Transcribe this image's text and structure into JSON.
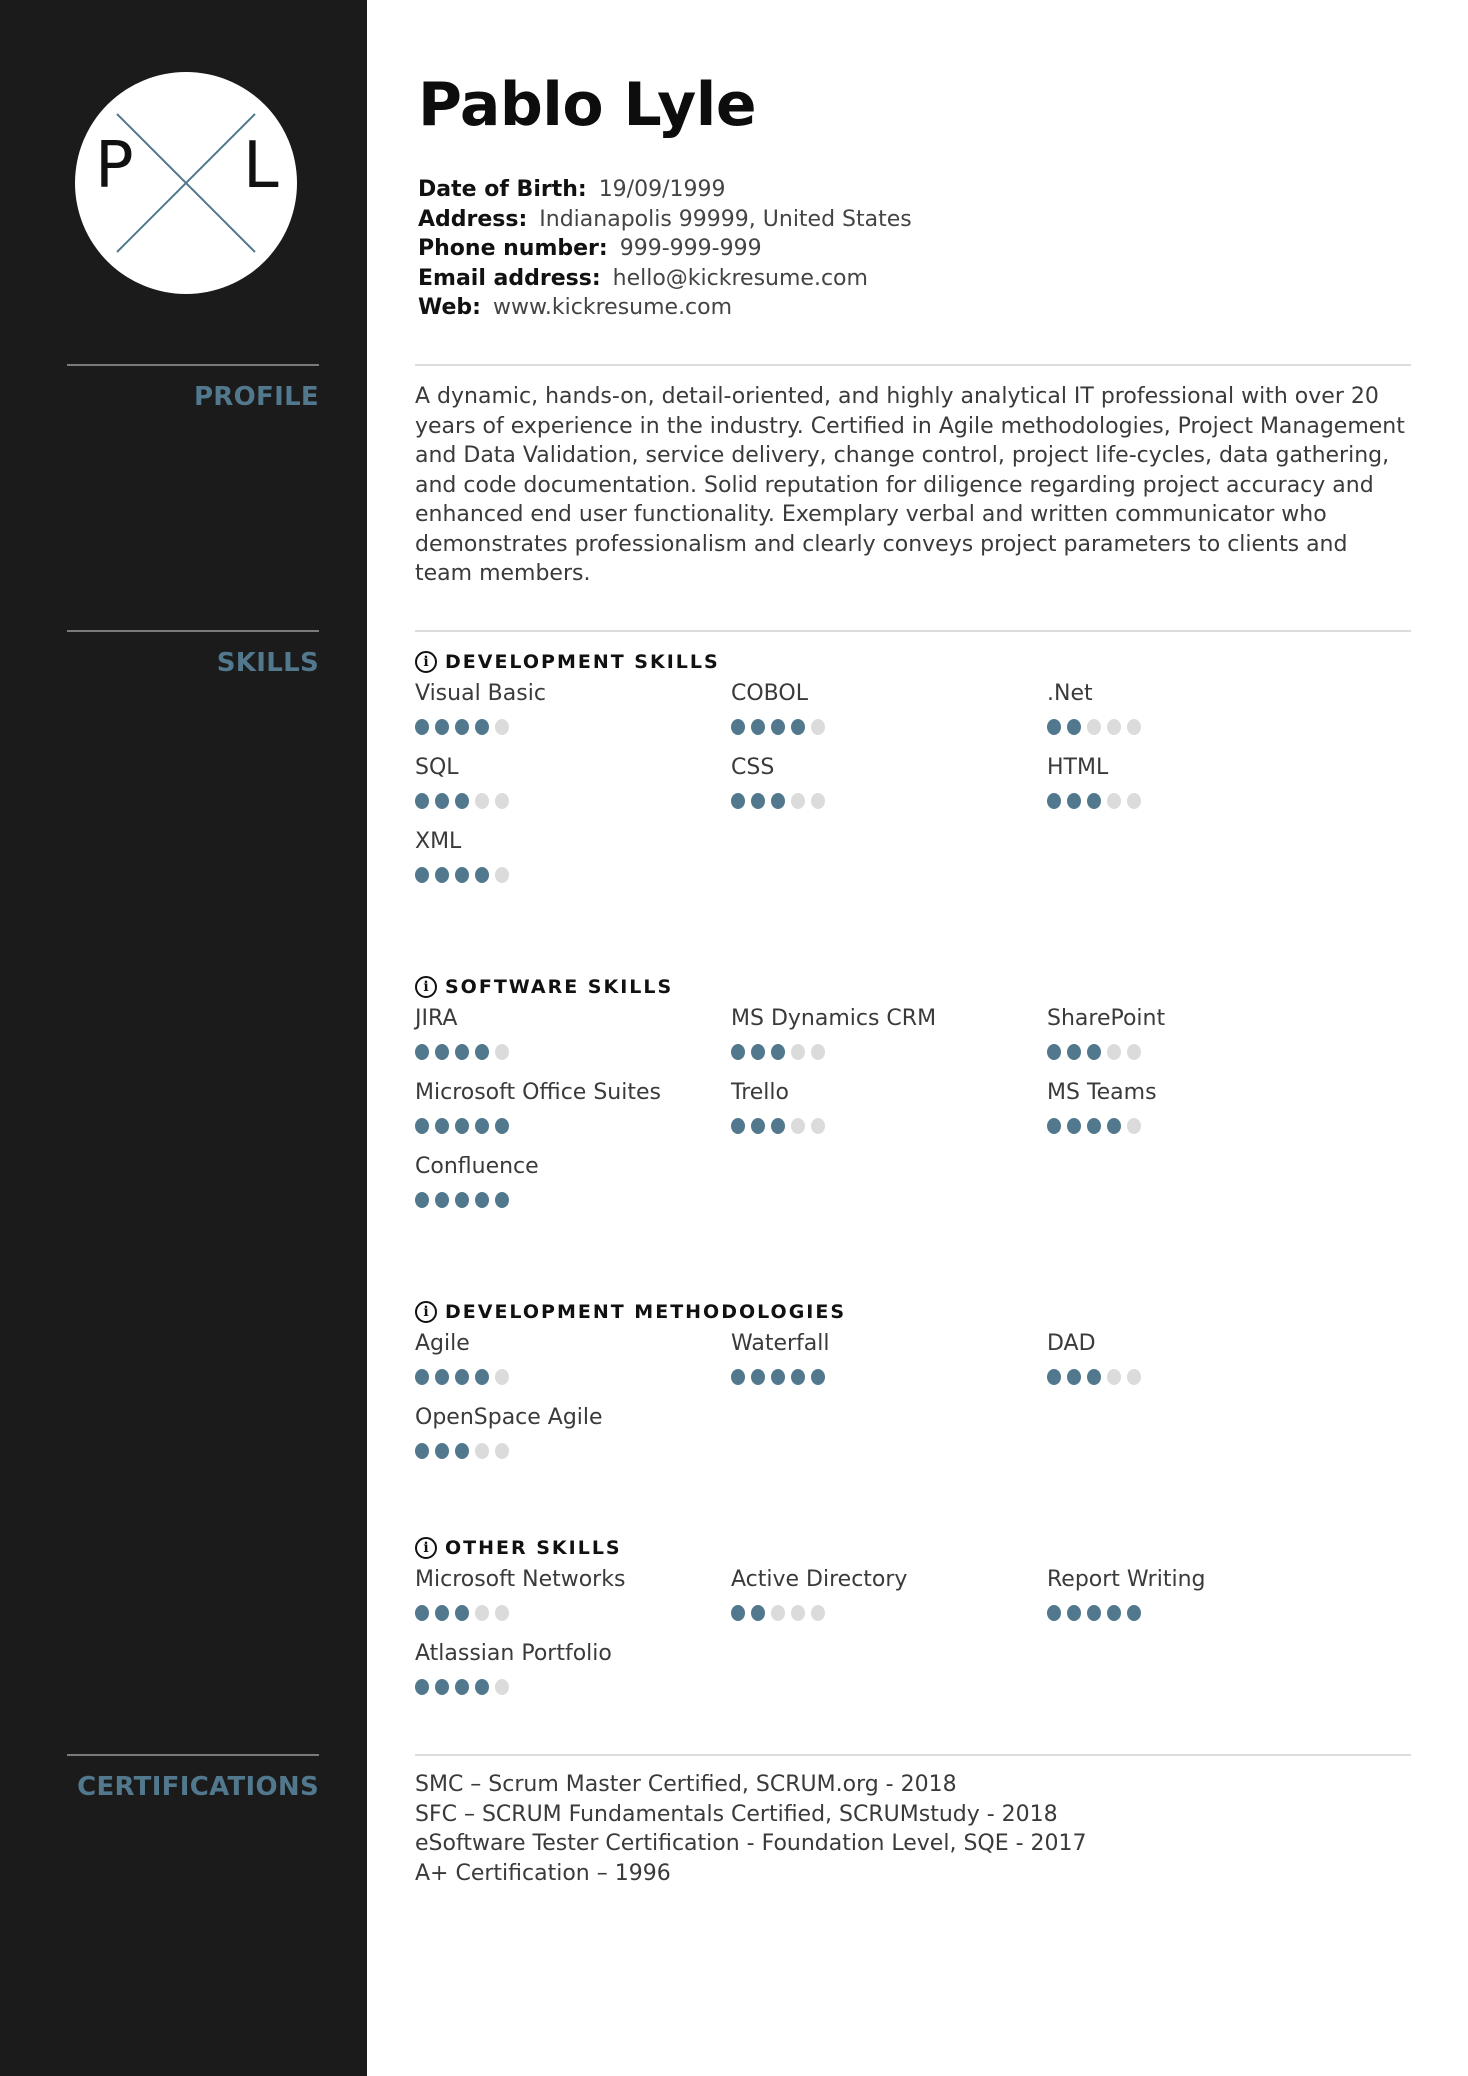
{
  "colors": {
    "accent": "#52788d",
    "sidebar": "#1b1b1b",
    "dot_off": "#dbdbdb"
  },
  "avatar": {
    "left_initial": "P",
    "right_initial": "L"
  },
  "header": {
    "name": "Pablo Lyle",
    "contact": [
      {
        "label": "Date of Birth:",
        "value": "19/09/1999"
      },
      {
        "label": "Address:",
        "value": "Indianapolis 99999, United States"
      },
      {
        "label": "Phone number:",
        "value": "999-999-999"
      },
      {
        "label": "Email address:",
        "value": "hello@kickresume.com"
      },
      {
        "label": "Web:",
        "value": "www.kickresume.com"
      }
    ]
  },
  "sidebar": {
    "sections": [
      {
        "title": "PROFILE"
      },
      {
        "title": "SKILLS"
      },
      {
        "title": "CERTIFICATIONS"
      }
    ]
  },
  "profile": {
    "text": "A dynamic, hands-on, detail-oriented, and highly analytical IT professional with over 20 years of experience in the industry. Certified in Agile methodologies, Project Management and Data Validation, service delivery, change control, project life-cycles, data gathering, and code documentation. Solid reputation for diligence regarding project accuracy and enhanced end user functionality. Exemplary verbal and written communicator who demonstrates professionalism and clearly conveys project parameters to clients and team members."
  },
  "skills": {
    "max_level": 5,
    "groups": [
      {
        "title": "DEVELOPMENT SKILLS",
        "icon": "info-icon",
        "items": [
          {
            "name": "Visual Basic",
            "level": 4
          },
          {
            "name": "COBOL",
            "level": 4
          },
          {
            "name": ".Net",
            "level": 2
          },
          {
            "name": "SQL",
            "level": 3
          },
          {
            "name": "CSS",
            "level": 3
          },
          {
            "name": "HTML",
            "level": 3
          },
          {
            "name": "XML",
            "level": 4
          }
        ]
      },
      {
        "title": "SOFTWARE SKILLS",
        "icon": "info-icon",
        "items": [
          {
            "name": "JIRA",
            "level": 4
          },
          {
            "name": "MS Dynamics CRM",
            "level": 3
          },
          {
            "name": "SharePoint",
            "level": 3
          },
          {
            "name": "Microsoft Office Suites",
            "level": 5
          },
          {
            "name": "Trello",
            "level": 3
          },
          {
            "name": "MS Teams",
            "level": 4
          },
          {
            "name": "Confluence",
            "level": 5
          }
        ]
      },
      {
        "title": "DEVELOPMENT METHODOLOGIES",
        "icon": "info-icon",
        "items": [
          {
            "name": "Agile",
            "level": 4
          },
          {
            "name": "Waterfall",
            "level": 5
          },
          {
            "name": "DAD",
            "level": 3
          },
          {
            "name": "OpenSpace Agile",
            "level": 3
          }
        ]
      },
      {
        "title": "OTHER SKILLS",
        "icon": "info-icon",
        "items": [
          {
            "name": "Microsoft Networks",
            "level": 3
          },
          {
            "name": "Active Directory",
            "level": 2
          },
          {
            "name": "Report Writing",
            "level": 5
          },
          {
            "name": "Atlassian Portfolio",
            "level": 4
          }
        ]
      }
    ]
  },
  "certifications": [
    "SMC – Scrum Master Certified, SCRUM.org - 2018",
    "SFC – SCRUM Fundamentals Certified, SCRUMstudy - 2018",
    "eSoftware Tester Certification - Foundation Level, SQE - 2017",
    "A+ Certification – 1996"
  ]
}
